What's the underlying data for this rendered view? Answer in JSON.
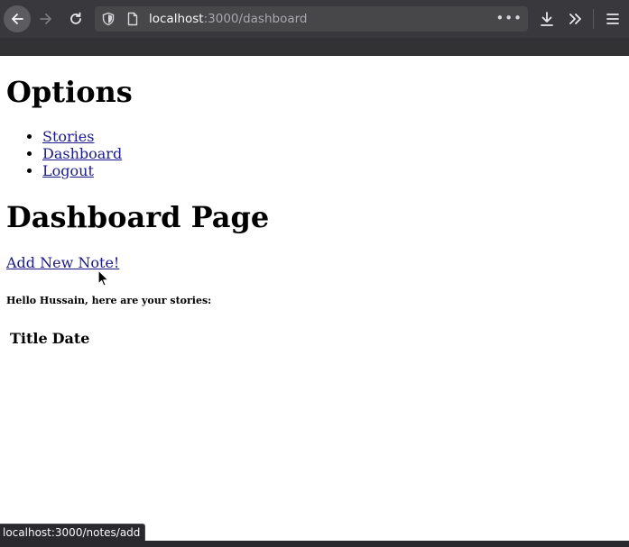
{
  "browser": {
    "url_host": "localhost",
    "url_rest": ":3000/dashboard",
    "status_url": "localhost:3000/notes/add",
    "overflow_menu_label": "•••"
  },
  "page": {
    "options_heading": "Options",
    "nav_links": [
      "Stories",
      "Dashboard",
      "Logout"
    ],
    "dashboard_heading": "Dashboard Page",
    "add_note_link": "Add New Note!",
    "greeting": "Hello Hussain, here are your stories:",
    "table_headers": [
      "Title",
      "Date"
    ]
  },
  "colors": {
    "toolbar_bg": "#38383d",
    "urlbar_bg": "#474749",
    "link": "#1a1a8c"
  }
}
